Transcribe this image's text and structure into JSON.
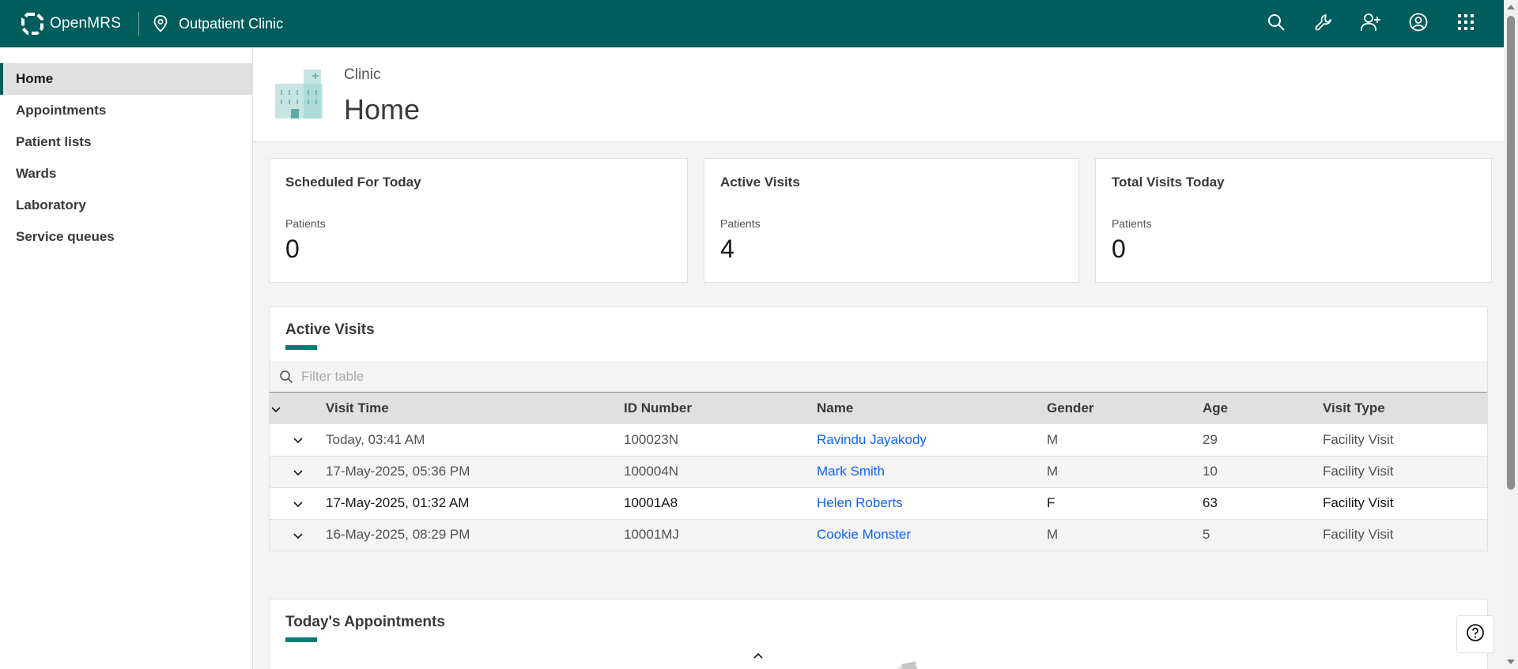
{
  "header": {
    "brand": "OpenMRS",
    "location": "Outpatient Clinic",
    "actions": [
      {
        "name": "search-icon"
      },
      {
        "name": "wrench-icon"
      },
      {
        "name": "add-user-icon"
      },
      {
        "name": "user-avatar-icon"
      },
      {
        "name": "app-switcher-icon"
      }
    ]
  },
  "sidebar": {
    "items": [
      {
        "label": "Home",
        "active": true
      },
      {
        "label": "Appointments"
      },
      {
        "label": "Patient lists"
      },
      {
        "label": "Wards"
      },
      {
        "label": "Laboratory"
      },
      {
        "label": "Service queues"
      }
    ]
  },
  "page": {
    "subtitle": "Clinic",
    "title": "Home"
  },
  "metrics": [
    {
      "title": "Scheduled For Today",
      "label": "Patients",
      "value": "0"
    },
    {
      "title": "Active Visits",
      "label": "Patients",
      "value": "4"
    },
    {
      "title": "Total Visits Today",
      "label": "Patients",
      "value": "0"
    }
  ],
  "active_visits": {
    "heading": "Active Visits",
    "filter_placeholder": "Filter table",
    "columns": [
      "Visit Time",
      "ID Number",
      "Name",
      "Gender",
      "Age",
      "Visit Type"
    ],
    "rows": [
      {
        "time": "Today, 03:41 AM",
        "id": "100023N",
        "name": "Ravindu Jayakody",
        "gender": "M",
        "age": "29",
        "type": "Facility Visit"
      },
      {
        "time": "17-May-2025, 05:36 PM",
        "id": "100004N",
        "name": "Mark Smith",
        "gender": "M",
        "age": "10",
        "type": "Facility Visit"
      },
      {
        "time": "17-May-2025, 01:32 AM",
        "id": "10001A8",
        "name": "Helen Roberts",
        "gender": "F",
        "age": "63",
        "type": "Facility Visit"
      },
      {
        "time": "16-May-2025, 08:29 PM",
        "id": "10001MJ",
        "name": "Cookie Monster",
        "gender": "M",
        "age": "5",
        "type": "Facility Visit"
      }
    ]
  },
  "appointments": {
    "heading": "Today's Appointments"
  },
  "colors": {
    "brand": "#005d5d",
    "accent": "#007d79",
    "link": "#0f62fe"
  }
}
